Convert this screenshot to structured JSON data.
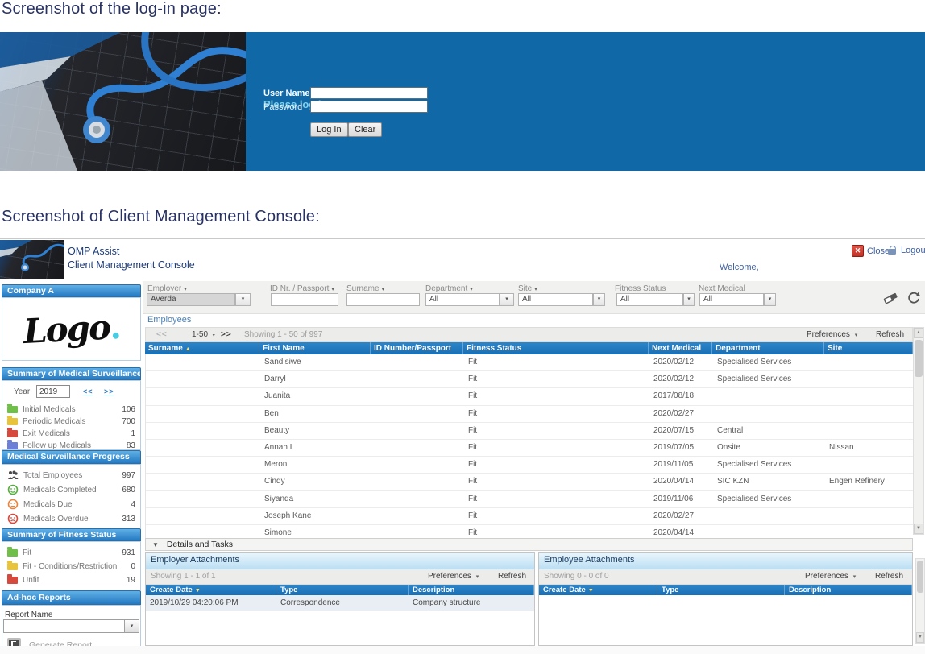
{
  "page": {
    "login_heading": "Screenshot of the log-in page:",
    "console_heading": "Screenshot of Client Management Console:"
  },
  "login": {
    "title": "Please log in.",
    "username_label": "User Name",
    "password_label": "Password",
    "login_button": "Log In",
    "clear_button": "Clear"
  },
  "console_header": {
    "app_name": "OMP Assist",
    "app_subtitle": "Client Management Console",
    "close": "Close",
    "logout": "Logout",
    "welcome": "Welcome,"
  },
  "filters": {
    "employer_label": "Employer",
    "employer_value": "Averda",
    "id_label": "ID Nr. / Passport",
    "surname_label": "Surname",
    "department_label": "Department",
    "department_value": "All",
    "site_label": "Site",
    "site_value": "All",
    "fitness_label": "Fitness Status",
    "fitness_value": "All",
    "next_medical_label": "Next Medical",
    "next_medical_value": "All"
  },
  "sidebar": {
    "company_name": "Company A",
    "logo_text": "Logo",
    "logo_dot": ".",
    "surveillance_title": "Summary of Medical Surveillance",
    "year_label": "Year",
    "year_value": "2019",
    "prev_link": "<<",
    "next_link": ">>",
    "surveillance_rows": [
      {
        "label": "Initial Medicals",
        "value": "106"
      },
      {
        "label": "Periodic Medicals",
        "value": "700"
      },
      {
        "label": "Exit Medicals",
        "value": "1"
      },
      {
        "label": "Follow up Medicals",
        "value": "83"
      }
    ],
    "progress_title": "Medical Surveillance Progress",
    "progress_rows": [
      {
        "label": "Total Employees",
        "value": "997"
      },
      {
        "label": "Medicals Completed",
        "value": "680"
      },
      {
        "label": "Medicals Due",
        "value": "4"
      },
      {
        "label": "Medicals Overdue",
        "value": "313"
      }
    ],
    "fitness_title": "Summary of Fitness Status",
    "fitness_rows": [
      {
        "label": "Fit",
        "value": "931"
      },
      {
        "label": "Fit - Conditions/Restriction",
        "value": "0"
      },
      {
        "label": "Unfit",
        "value": "19"
      }
    ],
    "adhoc_title": "Ad-hoc Reports",
    "report_name_label": "Report Name",
    "generate_report_label": "Generate Report"
  },
  "employees": {
    "section_title": "Employees",
    "pager_prev": "<<",
    "pager_range": "1-50",
    "pager_next": ">>",
    "showing": "Showing 1 - 50 of 997",
    "preferences": "Preferences",
    "refresh": "Refresh",
    "columns": [
      "Surname",
      "First Name",
      "ID Number/Passport",
      "Fitness Status",
      "Next Medical",
      "Department",
      "Site"
    ],
    "rows": [
      {
        "surname": "",
        "first_name": "Sandisiwe",
        "id_number": "",
        "fitness": "Fit",
        "next_medical": "2020/02/12",
        "department": "Specialised Services",
        "site": ""
      },
      {
        "surname": "",
        "first_name": "Darryl",
        "id_number": "",
        "fitness": "Fit",
        "next_medical": "2020/02/12",
        "department": "Specialised Services",
        "site": ""
      },
      {
        "surname": "",
        "first_name": "Juanita",
        "id_number": "",
        "fitness": "Fit",
        "next_medical": "2017/08/18",
        "department": "",
        "site": ""
      },
      {
        "surname": "",
        "first_name": "Ben",
        "id_number": "",
        "fitness": "Fit",
        "next_medical": "2020/02/27",
        "department": "",
        "site": ""
      },
      {
        "surname": "",
        "first_name": "Beauty",
        "id_number": "",
        "fitness": "Fit",
        "next_medical": "2020/07/15",
        "department": "Central",
        "site": ""
      },
      {
        "surname": "",
        "first_name": "Annah L",
        "id_number": "",
        "fitness": "Fit",
        "next_medical": "2019/07/05",
        "department": "Onsite",
        "site": "Nissan"
      },
      {
        "surname": "",
        "first_name": "Meron",
        "id_number": "",
        "fitness": "Fit",
        "next_medical": "2019/11/05",
        "department": "Specialised Services",
        "site": ""
      },
      {
        "surname": "",
        "first_name": "Cindy",
        "id_number": "",
        "fitness": "Fit",
        "next_medical": "2020/04/14",
        "department": "SIC KZN",
        "site": "Engen Refinery"
      },
      {
        "surname": "",
        "first_name": "Siyanda",
        "id_number": "",
        "fitness": "Fit",
        "next_medical": "2019/11/06",
        "department": "Specialised Services",
        "site": ""
      },
      {
        "surname": "",
        "first_name": "Joseph Kane",
        "id_number": "",
        "fitness": "Fit",
        "next_medical": "2020/02/27",
        "department": "",
        "site": ""
      },
      {
        "surname": "",
        "first_name": "Simone",
        "id_number": "",
        "fitness": "Fit",
        "next_medical": "2020/04/14",
        "department": "",
        "site": ""
      }
    ]
  },
  "details": {
    "title": "Details and Tasks"
  },
  "employer_attachments": {
    "title": "Employer Attachments",
    "showing": "Showing 1 - 1 of 1",
    "preferences": "Preferences",
    "refresh": "Refresh",
    "columns": [
      "Create Date",
      "Type",
      "Description"
    ],
    "rows": [
      {
        "create_date": "2019/10/29 04:20:06 PM",
        "type": "Correspondence",
        "description": "Company structure"
      }
    ]
  },
  "employee_attachments": {
    "title": "Employee Attachments",
    "showing": "Showing 0 - 0 of 0",
    "preferences": "Preferences",
    "refresh": "Refresh",
    "columns": [
      "Create Date",
      "Type",
      "Description"
    ],
    "rows": []
  },
  "icons": {
    "dropdown_arrow": "▾",
    "sort_asc": "▲",
    "sort_desc": "▼",
    "close_x": "✕",
    "collapse": "▼",
    "scroll_up": "▲",
    "scroll_down": "▼"
  },
  "colors": {
    "login_blue": "#1168a7",
    "section_header_blue": "#2579c1",
    "table_header_blue": "#1a6fb4",
    "link_blue": "#3e5fa3",
    "heading_navy": "#293264",
    "accent_cyan": "#49cbe0",
    "close_red": "#c22f23"
  }
}
